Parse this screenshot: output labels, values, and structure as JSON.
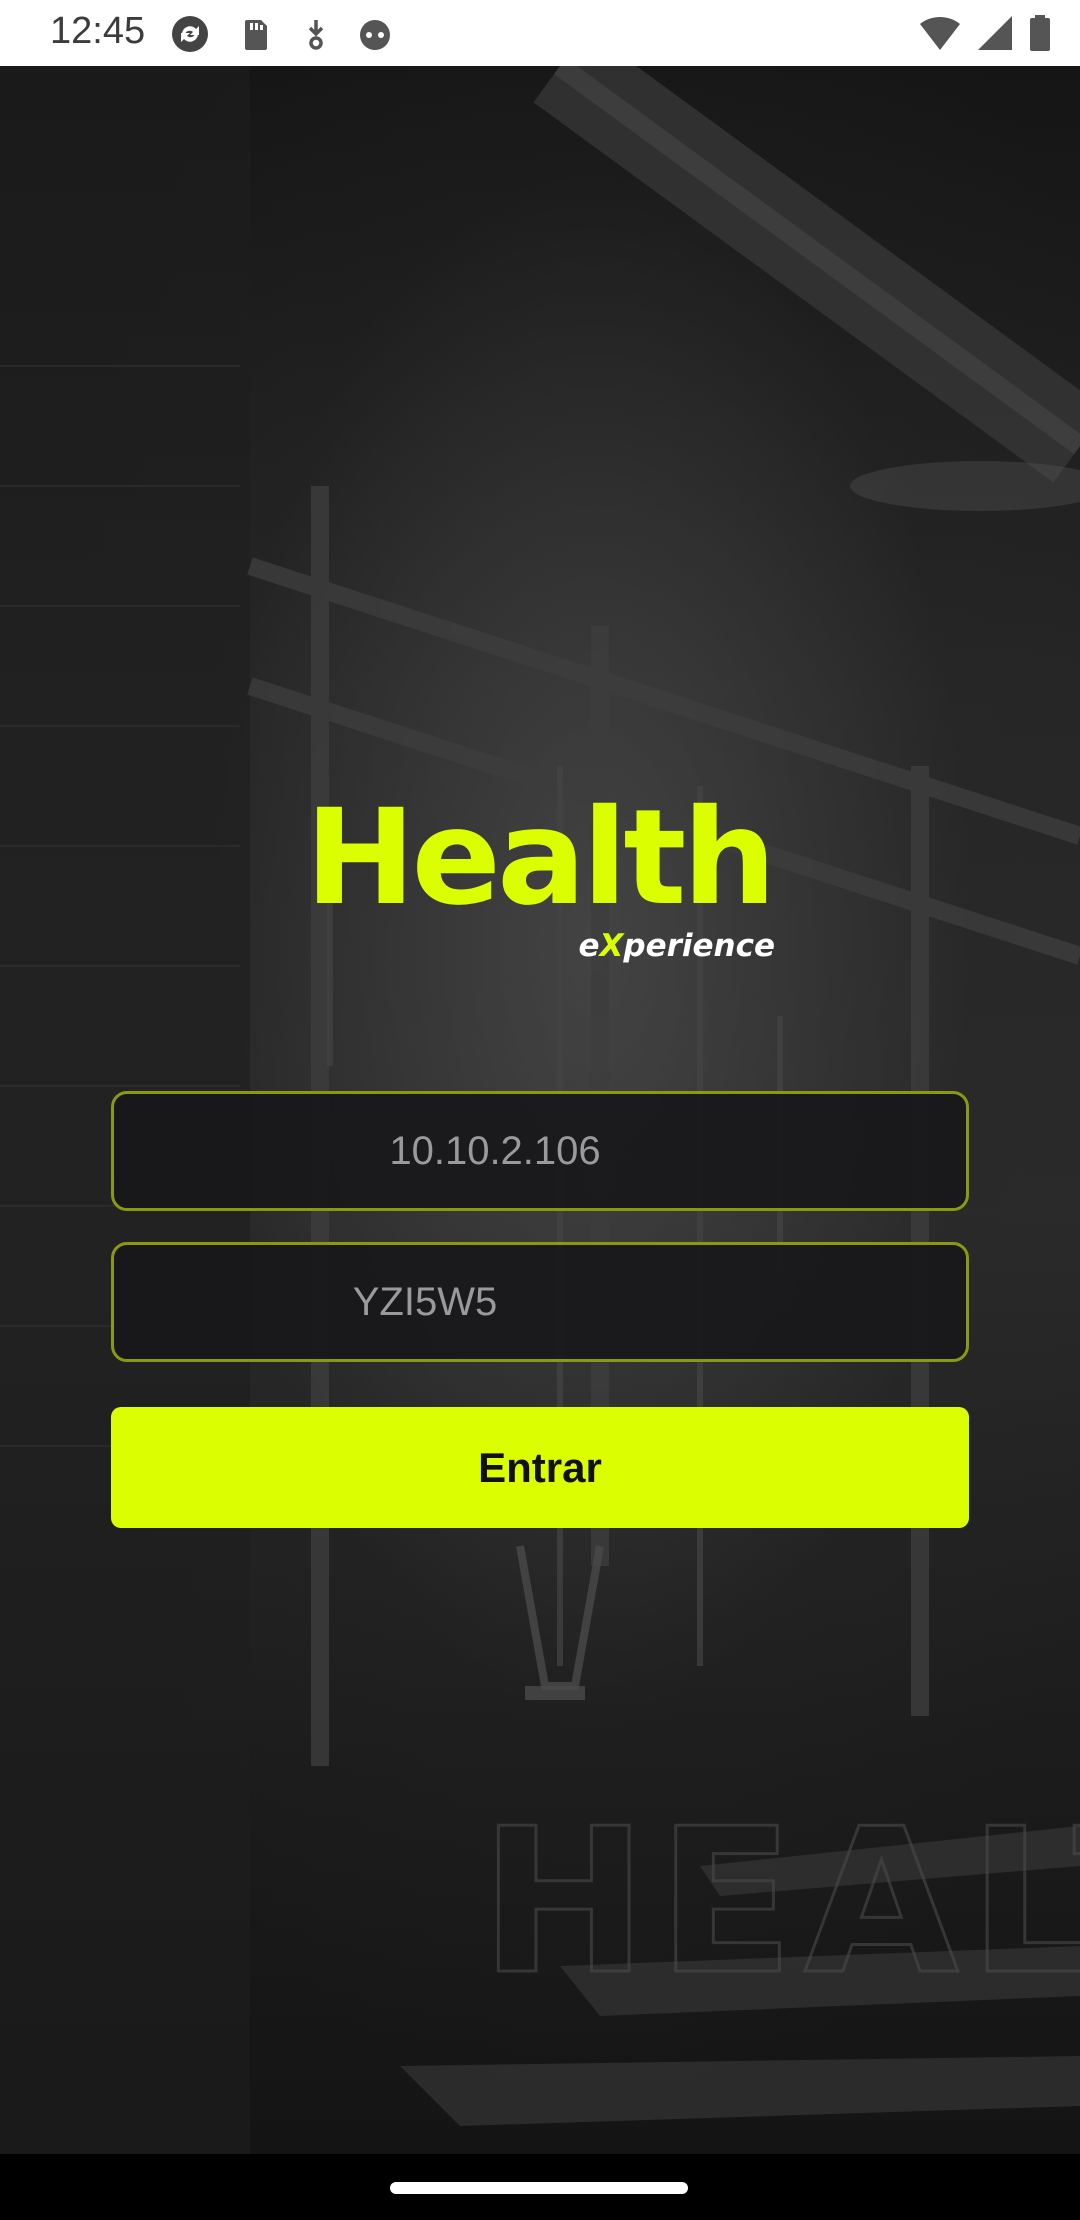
{
  "status_bar": {
    "time": "12:45",
    "left_icons": [
      "sync-icon",
      "sd-card-icon",
      "download-icon",
      "face-icon"
    ],
    "right_icons": [
      "wifi-icon",
      "signal-icon",
      "battery-icon"
    ]
  },
  "brand": {
    "title": "Health",
    "subtitle_prefix": "e",
    "subtitle_x": "X",
    "subtitle_suffix": "perience",
    "accent_color": "#dcff00"
  },
  "form": {
    "server_field": {
      "value": "10.10.2.106",
      "placeholder": ""
    },
    "code_field": {
      "value": "YZI5W5",
      "placeholder": ""
    },
    "submit_label": "Entrar"
  },
  "background": {
    "watermark_text": "HEALTH"
  }
}
